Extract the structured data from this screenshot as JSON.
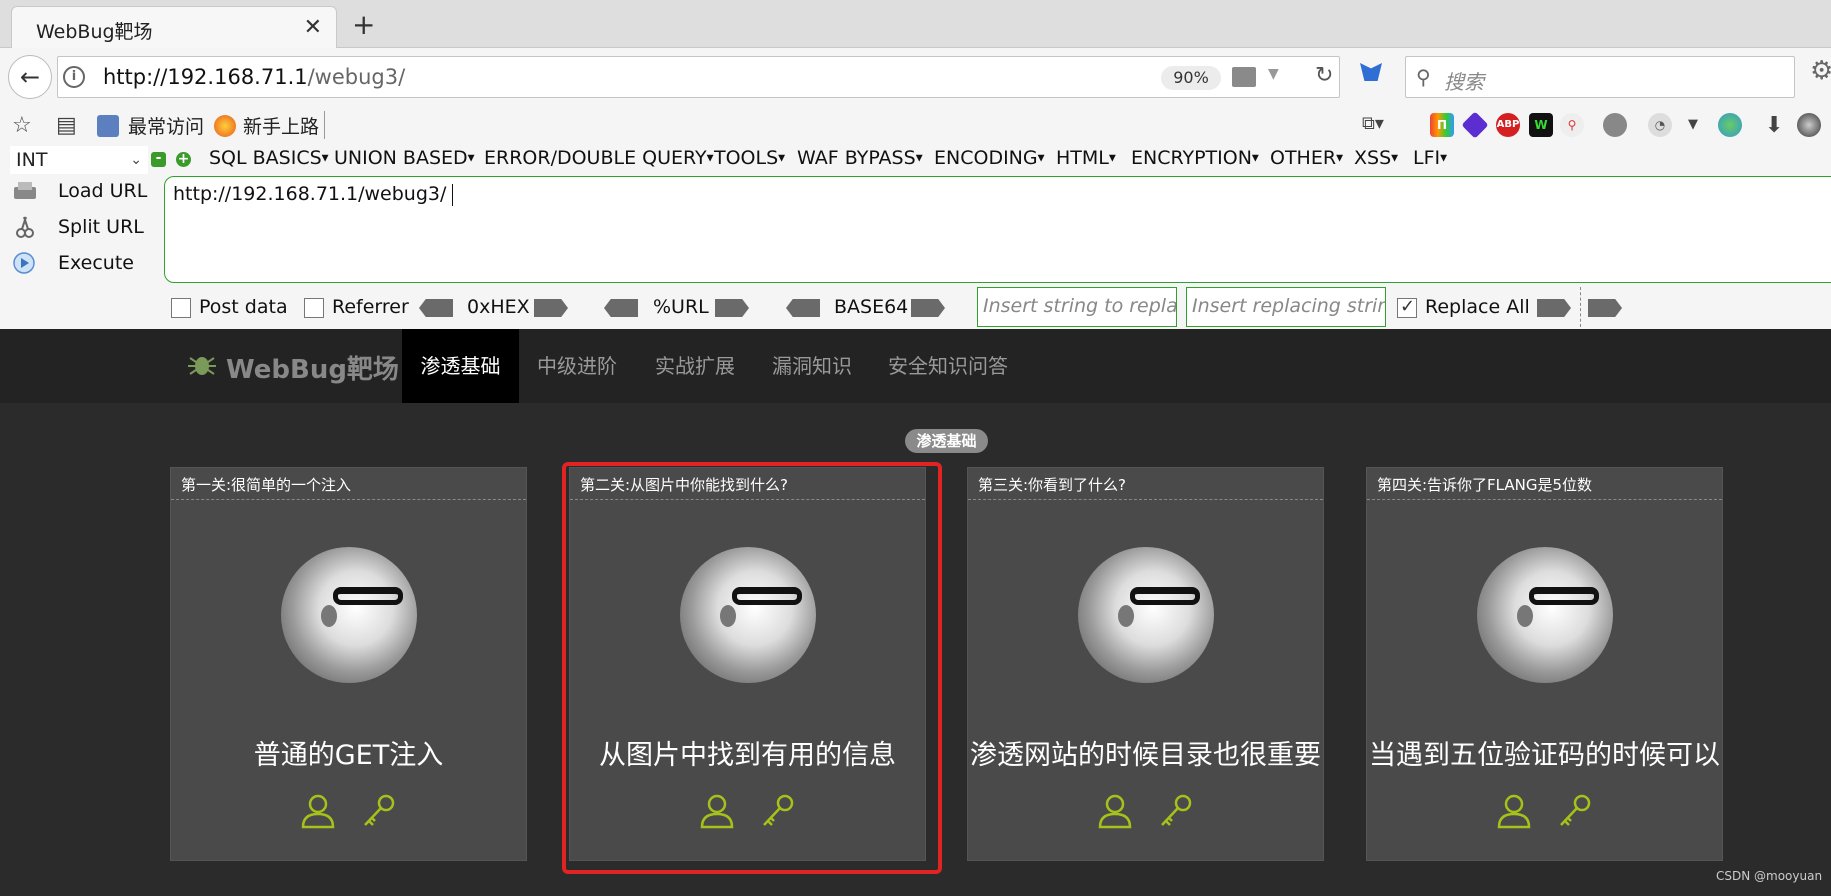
{
  "browser": {
    "tab_title": "WebBug靶场",
    "tab_close": "✕",
    "new_tab": "+",
    "url_host": "http://192.168.71.1",
    "url_path": "/webug3/",
    "zoom": "90%",
    "search_placeholder": "搜索",
    "bookmarks": [
      "最常访问",
      "新手上路"
    ]
  },
  "hackbar": {
    "mode": "INT",
    "menus": [
      "SQL BASICS",
      "UNION BASED",
      "ERROR/DOUBLE QUERY",
      "TOOLS",
      "WAF BYPASS",
      "ENCODING",
      "HTML",
      "ENCRYPTION",
      "OTHER",
      "XSS",
      "LFI"
    ],
    "actions": [
      "Load URL",
      "Split URL",
      "Execute"
    ],
    "url_value": "http://192.168.71.1/webug3/",
    "post_data_label": "Post data",
    "referrer_label": "Referrer",
    "encodings": [
      "0xHEX",
      "%URL",
      "BASE64"
    ],
    "insert_string_placeholder": "Insert string to replace",
    "insert_replacing_placeholder": "Insert replacing string",
    "replace_all_label": "Replace All",
    "replace_all_checked": true
  },
  "site": {
    "logo_text": "WebBug靶场",
    "nav": [
      "渗透基础",
      "中级进阶",
      "实战扩展",
      "漏洞知识",
      "安全知识问答"
    ],
    "active_nav": "渗透基础",
    "section_badge": "渗透基础",
    "cards": [
      {
        "header": "第一关:很简单的一个注入",
        "title": "普通的GET注入"
      },
      {
        "header": "第二关:从图片中你能找到什么?",
        "title": "从图片中找到有用的信息"
      },
      {
        "header": "第三关:你看到了什么?",
        "title": "渗透网站的时候目录也很重要"
      },
      {
        "header": "第四关:告诉你了FLANG是5位数",
        "title": "当遇到五位验证码的时候可以"
      }
    ]
  },
  "watermark": "CSDN @mooyuan",
  "colors": {
    "highlight": "#e12323",
    "icon_lime": "#a6c21a",
    "hackbar_green": "#2fa12f"
  }
}
